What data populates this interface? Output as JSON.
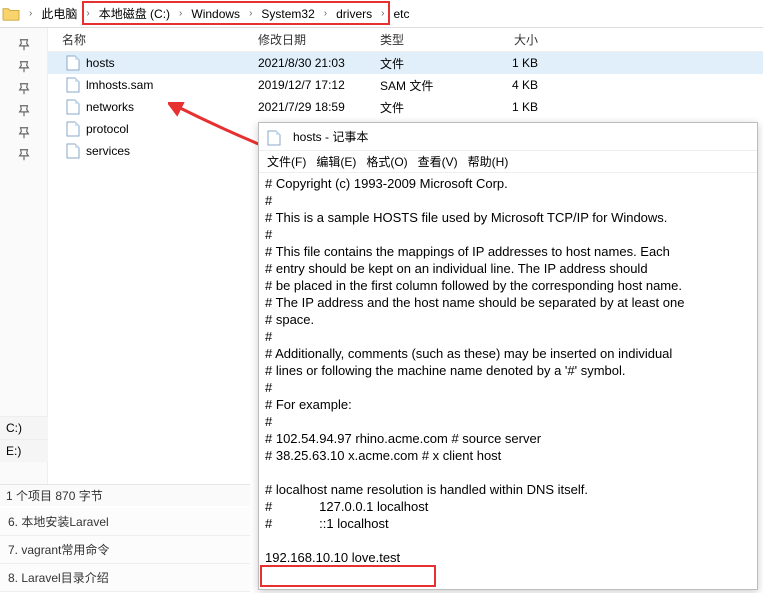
{
  "breadcrumb": {
    "root": "此电脑",
    "items": [
      "本地磁盘 (C:)",
      "Windows",
      "System32",
      "drivers",
      "etc"
    ]
  },
  "columns": {
    "name": "名称",
    "date": "修改日期",
    "type": "类型",
    "size": "大小"
  },
  "files": [
    {
      "name": "hosts",
      "date": "2021/8/30 21:03",
      "type": "文件",
      "size": "1 KB",
      "selected": true
    },
    {
      "name": "lmhosts.sam",
      "date": "2019/12/7 17:12",
      "type": "SAM 文件",
      "size": "4 KB",
      "selected": false
    },
    {
      "name": "networks",
      "date": "2021/7/29 18:59",
      "type": "文件",
      "size": "1 KB",
      "selected": false
    },
    {
      "name": "protocol",
      "date": "",
      "type": "",
      "size": "",
      "selected": false
    },
    {
      "name": "services",
      "date": "",
      "type": "",
      "size": "",
      "selected": false
    }
  ],
  "disks": {
    "c": "C:)",
    "e": "E:)"
  },
  "status": {
    "text": "1 个项目  870 字节"
  },
  "ext_items": [
    "6. 本地安装Laravel",
    "7. vagrant常用命令",
    "8. Laravel目录介绍"
  ],
  "notepad": {
    "title": "hosts - 记事本",
    "menu": {
      "file": "文件(F)",
      "edit": "编辑(E)",
      "format": "格式(O)",
      "view": "查看(V)",
      "help": "帮助(H)"
    },
    "content": "# Copyright (c) 1993-2009 Microsoft Corp.\n#\n# This is a sample HOSTS file used by Microsoft TCP/IP for Windows.\n#\n# This file contains the mappings of IP addresses to host names. Each\n# entry should be kept on an individual line. The IP address should\n# be placed in the first column followed by the corresponding host name.\n# The IP address and the host name should be separated by at least one\n# space.\n#\n# Additionally, comments (such as these) may be inserted on individual\n# lines or following the machine name denoted by a '#' symbol.\n#\n# For example:\n#\n# 102.54.94.97 rhino.acme.com # source server\n# 38.25.63.10 x.acme.com # x client host\n\n# localhost name resolution is handled within DNS itself.\n#             127.0.0.1 localhost\n#             ::1 localhost\n\n192.168.10.10 love.test"
  }
}
